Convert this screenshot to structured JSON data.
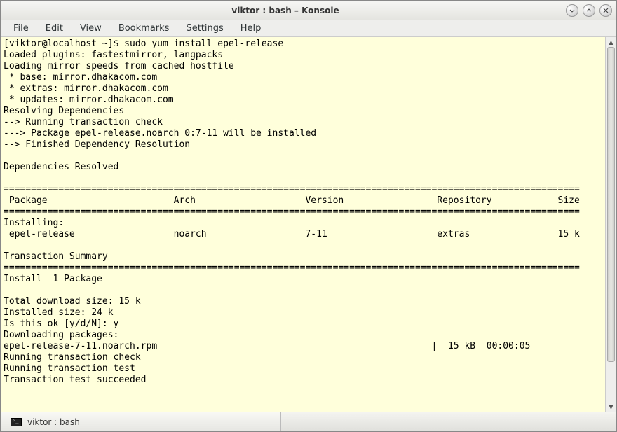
{
  "window": {
    "title": "viktor : bash – Konsole"
  },
  "menubar": {
    "file": "File",
    "edit": "Edit",
    "view": "View",
    "bookmarks": "Bookmarks",
    "settings": "Settings",
    "help": "Help"
  },
  "terminal": {
    "content": "[viktor@localhost ~]$ sudo yum install epel-release\nLoaded plugins: fastestmirror, langpacks\nLoading mirror speeds from cached hostfile\n * base: mirror.dhakacom.com\n * extras: mirror.dhakacom.com\n * updates: mirror.dhakacom.com\nResolving Dependencies\n--> Running transaction check\n---> Package epel-release.noarch 0:7-11 will be installed\n--> Finished Dependency Resolution\n\nDependencies Resolved\n\n=========================================================================================================\n Package                       Arch                    Version                 Repository            Size\n=========================================================================================================\nInstalling:\n epel-release                  noarch                  7-11                    extras                15 k\n\nTransaction Summary\n=========================================================================================================\nInstall  1 Package\n\nTotal download size: 15 k\nInstalled size: 24 k\nIs this ok [y/d/N]: y\nDownloading packages:\nepel-release-7-11.noarch.rpm                                                  |  15 kB  00:00:05\nRunning transaction check\nRunning transaction test\nTransaction test succeeded"
  },
  "taskbar": {
    "tab_label": "viktor : bash"
  }
}
